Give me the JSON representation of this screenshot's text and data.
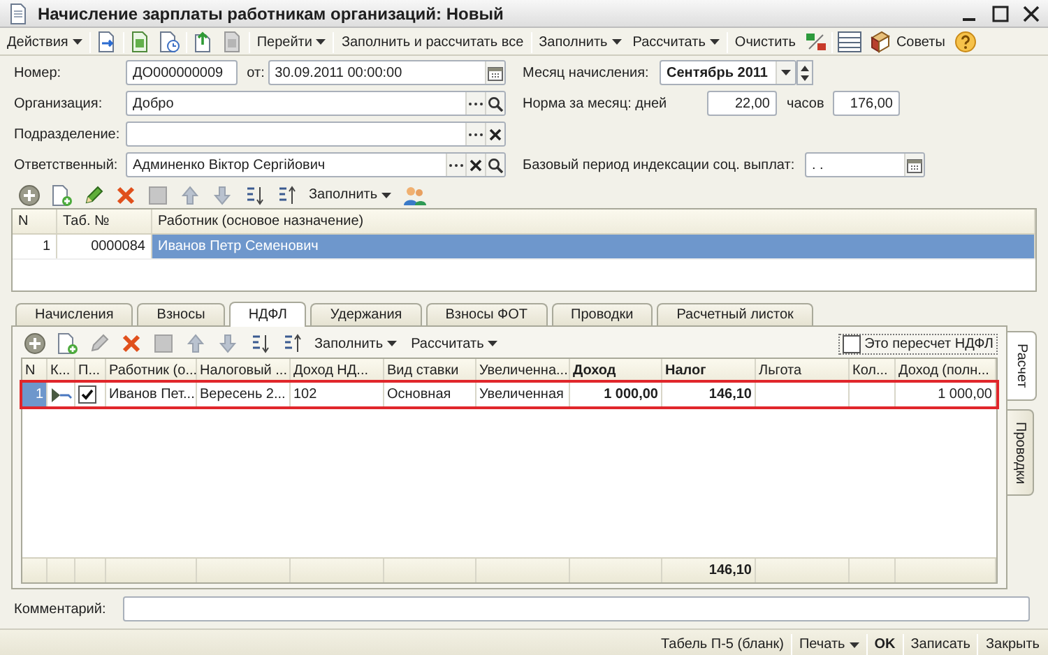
{
  "window": {
    "title": "Начисление зарплаты работникам организаций: Новый"
  },
  "toolbar": [
    {
      "kind": "dropdown",
      "label": "Действия"
    },
    {
      "kind": "dropdown",
      "label": "Перейти"
    },
    {
      "kind": "button",
      "label": "Заполнить и рассчитать все"
    },
    {
      "kind": "dropdown",
      "label": "Заполнить"
    },
    {
      "kind": "dropdown",
      "label": "Рассчитать"
    },
    {
      "kind": "button",
      "label": "Очистить"
    },
    {
      "kind": "icon_button",
      "label": "Советы"
    }
  ],
  "header": {
    "number": {
      "label": "Номер:",
      "value": "ДО000000009"
    },
    "date": {
      "label": "от:",
      "value": "30.09.2011 00:00:00"
    },
    "organization": {
      "label": "Организация:",
      "value": "Добро"
    },
    "department": {
      "label": "Подразделение:"
    },
    "responsible": {
      "label": "Ответственный:",
      "value": "Админенко Віктор Сергійович"
    },
    "month": {
      "label": "Месяц начисления:",
      "value": "Сентябрь 2011"
    },
    "norm": {
      "label": "Норма за месяц: дней",
      "days": "22,00",
      "hours_label": "часов",
      "hours": "176,00"
    },
    "base_period": {
      "label": "Базовый период индексации соц. выплат:",
      "value": ". ."
    }
  },
  "employees": {
    "toolbar": [
      {
        "kind": "dropdown",
        "label": "Заполнить"
      }
    ],
    "columns": [
      {
        "label": "N"
      },
      {
        "label": "Таб. №"
      },
      {
        "label": "Работник (основое назначение)"
      }
    ],
    "rows": [
      {
        "cells": [
          "1",
          "0000084",
          "Иванов Петр Семенович"
        ],
        "selected": true
      }
    ]
  },
  "tabs": [
    {
      "label": "Начисления",
      "selected": false
    },
    {
      "label": "Взносы",
      "selected": false
    },
    {
      "label": "НДФЛ",
      "selected": true
    },
    {
      "label": "Удержания",
      "selected": false
    },
    {
      "label": "Взносы ФОТ",
      "selected": false
    },
    {
      "label": "Проводки",
      "selected": false
    },
    {
      "label": "Расчетный листок",
      "selected": false
    }
  ],
  "tax": {
    "toolbar": [
      {
        "kind": "dropdown",
        "label": "Заполнить"
      },
      {
        "kind": "dropdown",
        "label": "Рассчитать"
      }
    ],
    "recalc": {
      "label": "Это пересчет НДФЛ",
      "checked": false
    },
    "columns": [
      {
        "label": "N",
        "bold": false
      },
      {
        "label": "К...",
        "bold": false
      },
      {
        "label": "П...",
        "bold": false
      },
      {
        "label": "Работник (о...",
        "bold": false
      },
      {
        "label": "Налоговый ...",
        "bold": false
      },
      {
        "label": "Доход НД...",
        "bold": false
      },
      {
        "label": "Вид ставки",
        "bold": false
      },
      {
        "label": "Увеличенна...",
        "bold": false
      },
      {
        "label": "Доход",
        "bold": true
      },
      {
        "label": "Налог",
        "bold": true,
        "total": "146,10"
      },
      {
        "label": "Льгота",
        "bold": false
      },
      {
        "label": "Кол...",
        "bold": false
      },
      {
        "label": "Доход (полн...",
        "bold": false
      }
    ],
    "rows": [
      {
        "selected": true,
        "highlighted": true,
        "cells": [
          {
            "kind": "text",
            "text": "1"
          },
          {
            "kind": "icon"
          },
          {
            "kind": "check",
            "checked": true
          },
          {
            "kind": "text",
            "text": "Иванов Пет..."
          },
          {
            "kind": "text",
            "text": "Вересень 2..."
          },
          {
            "kind": "text",
            "text": "102"
          },
          {
            "kind": "text",
            "text": "Основная"
          },
          {
            "kind": "text",
            "text": "Увеличенная"
          },
          {
            "kind": "text",
            "text": "1 000,00"
          },
          {
            "kind": "text",
            "text": "146,10"
          },
          {
            "kind": "empty"
          },
          {
            "kind": "empty"
          },
          {
            "kind": "text",
            "text": "1 000,00"
          }
        ]
      }
    ]
  },
  "side_tabs": [
    {
      "label": "Расчет",
      "selected": true
    },
    {
      "label": "Проводки",
      "selected": false
    }
  ],
  "comment": {
    "label": "Комментарий:"
  },
  "buttons": [
    {
      "kind": "button",
      "label": "Табель П-5 (бланк)"
    },
    {
      "kind": "dropdown",
      "label": "Печать"
    },
    {
      "kind": "default",
      "label": "OK"
    },
    {
      "kind": "button",
      "label": "Записать"
    },
    {
      "kind": "button",
      "label": "Закрыть"
    }
  ]
}
